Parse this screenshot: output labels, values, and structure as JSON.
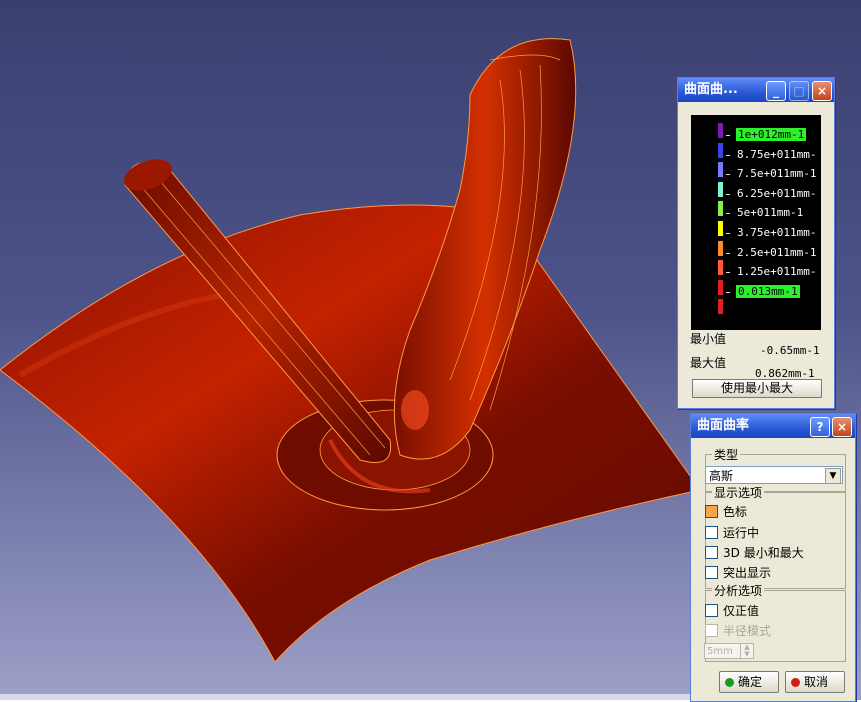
{
  "scale_window": {
    "title": "曲面曲...",
    "min_label": "最小值",
    "max_label": "最大值",
    "min_value": "-0.65mm-1",
    "max_value": "0.862mm-1",
    "use_minmax_button": "使用最小最大",
    "colors": [
      "#7a1cbc",
      "#3c44e6",
      "#7878ff",
      "#7ff0d0",
      "#88f048",
      "#ffff00",
      "#ff8a2a",
      "#ff5a3a",
      "#e02020",
      "#e02020"
    ],
    "labels": [
      "1e+012mm-1",
      "8.75e+011mm-",
      "7.5e+011mm-1",
      "6.25e+011mm-",
      "5e+011mm-1",
      "3.75e+011mm-",
      "2.5e+011mm-1",
      "1.25e+011mm-",
      "0.013mm-1"
    ]
  },
  "curvature_dialog": {
    "title": "曲面曲率",
    "type_group": "类型",
    "type_value": "高斯",
    "display_group": "显示选项",
    "display_options": [
      {
        "label": "色标",
        "checked": true
      },
      {
        "label": "运行中",
        "checked": false
      },
      {
        "label": "3D 最小和最大",
        "checked": false
      },
      {
        "label": "突出显示",
        "checked": false
      }
    ],
    "analysis_group": "分析选项",
    "positive_only": "仅正值",
    "radius_mode": "半径模式",
    "radius_value": "5mm",
    "ok_button": "确定",
    "cancel_button": "取消"
  },
  "title_buttons": {
    "minimize": "_",
    "maximize": "□",
    "close": "×",
    "help": "?"
  },
  "colors": {
    "surface": "#a81800",
    "edge": "#ff9a40",
    "titlebar": "#2959d6"
  }
}
